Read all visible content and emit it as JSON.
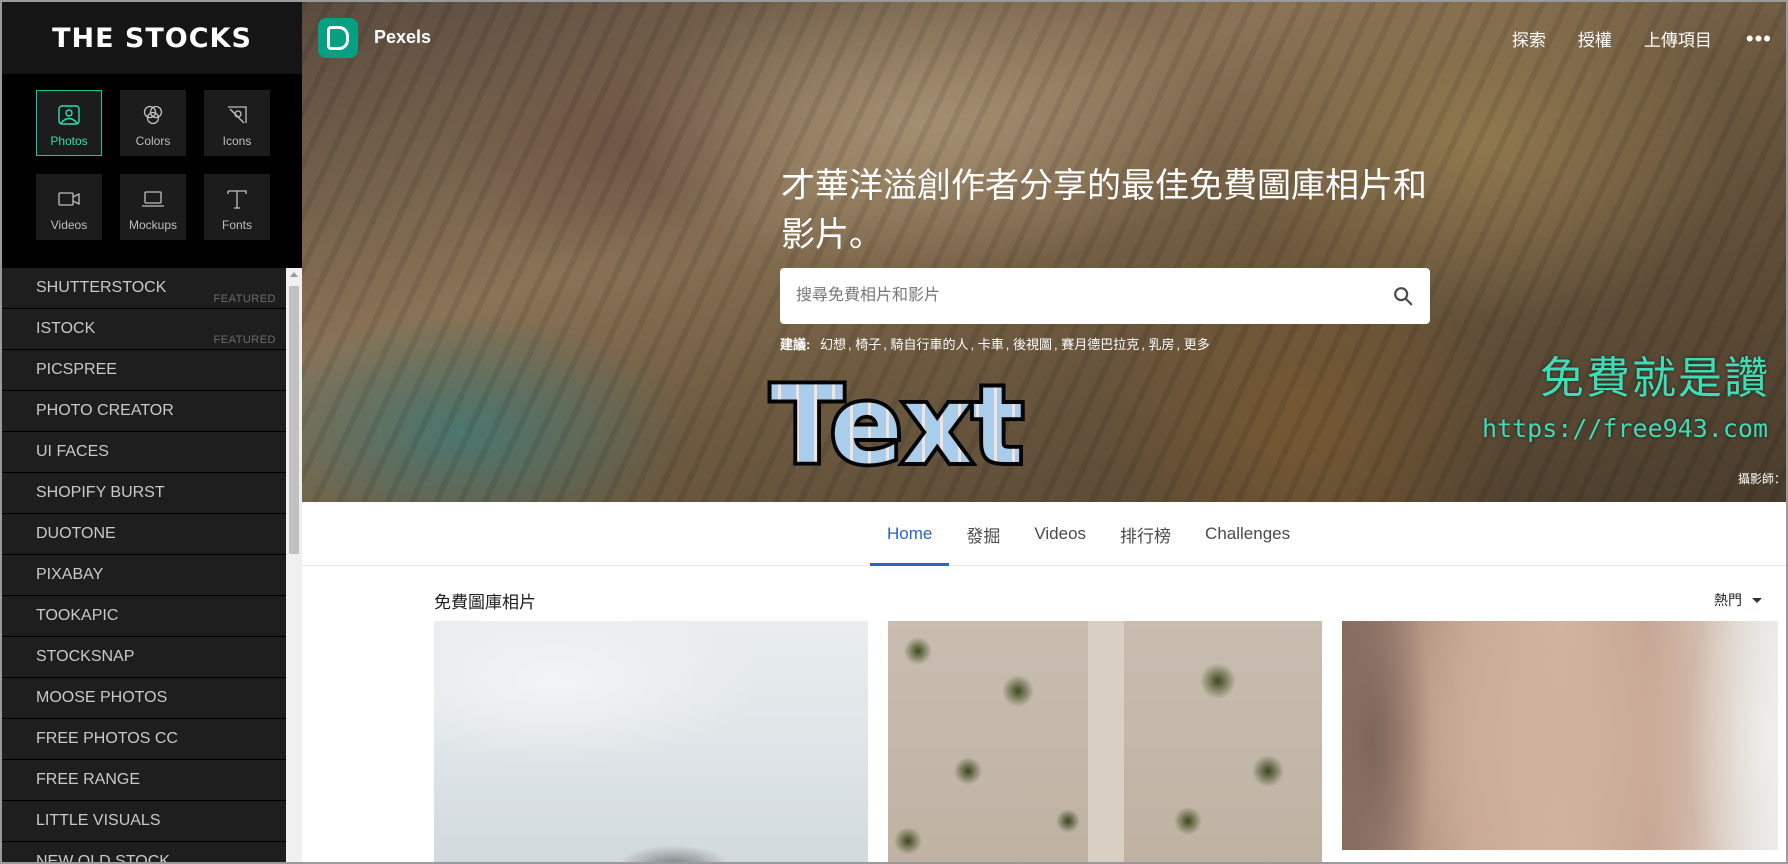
{
  "sidebar": {
    "brand": "THE STOCKS",
    "categories": [
      {
        "label": "Photos",
        "icon": "image-icon",
        "active": true
      },
      {
        "label": "Colors",
        "icon": "color-circles-icon"
      },
      {
        "label": "Icons",
        "icon": "icon-shape-icon"
      },
      {
        "label": "Videos",
        "icon": "video-camera-icon"
      },
      {
        "label": "Mockups",
        "icon": "laptop-icon"
      },
      {
        "label": "Fonts",
        "icon": "type-icon"
      }
    ],
    "sites": [
      {
        "name": "SHUTTERSTOCK",
        "tag": "FEATURED"
      },
      {
        "name": "ISTOCK",
        "tag": "FEATURED"
      },
      {
        "name": "PICSPREE"
      },
      {
        "name": "PHOTO CREATOR"
      },
      {
        "name": "UI FACES"
      },
      {
        "name": "SHOPIFY BURST"
      },
      {
        "name": "DUOTONE"
      },
      {
        "name": "PIXABAY"
      },
      {
        "name": "TOOKAPIC"
      },
      {
        "name": "STOCKSNAP"
      },
      {
        "name": "MOOSE PHOTOS"
      },
      {
        "name": "FREE PHOTOS CC"
      },
      {
        "name": "FREE RANGE"
      },
      {
        "name": "LITTLE VISUALS"
      },
      {
        "name": "NEW OLD STOCK"
      }
    ]
  },
  "pexels": {
    "brand": "Pexels",
    "nav": {
      "explore": "探索",
      "license": "授權",
      "upload": "上傳項目",
      "more": "•••"
    },
    "headline": "才華洋溢創作者分享的最佳免費圖庫相片和影片。",
    "search_placeholder": "搜尋免費相片和影片",
    "suggest_label": "建議:",
    "suggestions": [
      "幻想",
      "椅子",
      "騎自行車的人",
      "卡車",
      "後視圖",
      "賽月德巴拉克",
      "乳房",
      "更多"
    ],
    "tabs": [
      {
        "label": "Home",
        "active": true
      },
      {
        "label": "發掘"
      },
      {
        "label": "Videos"
      },
      {
        "label": "排行榜"
      },
      {
        "label": "Challenges"
      }
    ],
    "section_title": "免費圖庫相片",
    "sort_label": "熱門",
    "photographer_credit": "攝影師："
  },
  "overlay": {
    "text": "Text",
    "watermark_title": "免費就是讚",
    "watermark_url": "https://free943.com"
  },
  "colors": {
    "accent": "#16c79a",
    "pexels_green": "#05a081",
    "tab_active": "#2e63c6",
    "watermark": "#3fdcb8"
  }
}
